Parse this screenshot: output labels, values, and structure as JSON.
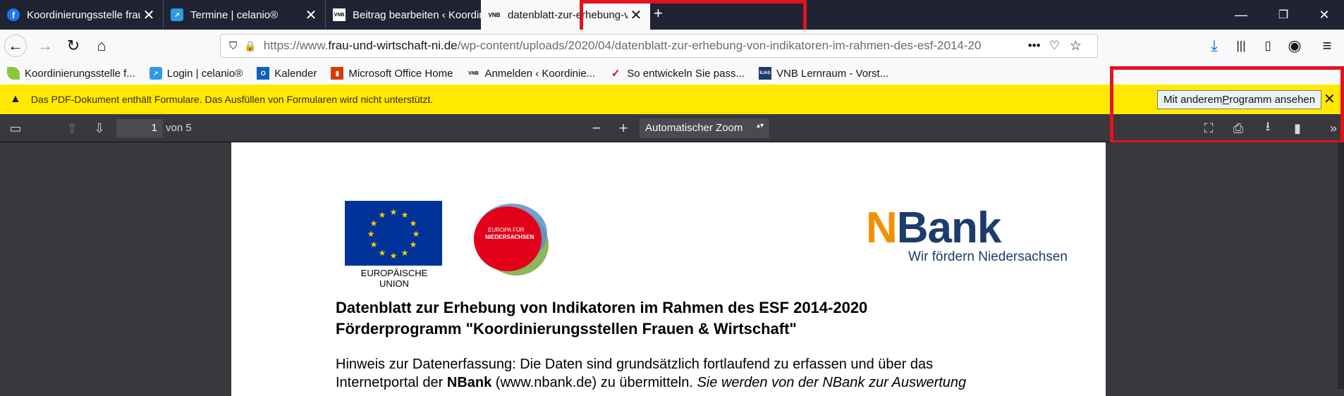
{
  "tabs": [
    {
      "title": "Koordinierungsstelle frau+wirtsc",
      "icon": "facebook-icon",
      "color": "#1877f2"
    },
    {
      "title": "Termine | celanio®",
      "icon": "celanio-icon",
      "color": "#2e9be6"
    },
    {
      "title": "Beitrag bearbeiten ‹ Koordinier",
      "icon": "vnb-icon",
      "color": "#ffffff"
    },
    {
      "title": "datenblatt-zur-erhebung-von-i",
      "icon": "vnb-icon",
      "color": "#ffffff",
      "active": true
    }
  ],
  "tab_favicon_text": {
    "vnb": "VNB"
  },
  "new_tab": "+",
  "url": {
    "prefix": "https://www.",
    "domain": "frau-und-wirtschaft-ni.de",
    "path": "/wp-content/uploads/2020/04/datenblatt-zur-erhebung-von-indikatoren-im-rahmen-des-esf-2014-20"
  },
  "bookmarks": [
    {
      "label": "Koordinierungsstelle f...",
      "icon": "bookmark-leaf-icon",
      "color": "#8cc63f"
    },
    {
      "label": "Login | celanio®",
      "icon": "celanio-icon",
      "color": "#2e9be6"
    },
    {
      "label": "Kalender",
      "icon": "outlook-icon",
      "color": "#0f5fbf"
    },
    {
      "label": "Microsoft Office Home",
      "icon": "office-icon",
      "color": "#d83b01"
    },
    {
      "label": "Anmelden ‹ Koordinie...",
      "icon": "vnb-icon",
      "color": "#ffffff"
    },
    {
      "label": "So entwickeln Sie pass...",
      "icon": "check-icon",
      "color": "#d0021b"
    },
    {
      "label": "VNB Lernraum - Vorst...",
      "icon": "ilias-icon",
      "color": "#1d3b6b"
    }
  ],
  "notification": {
    "message": "Das PDF-Dokument enthält Formulare. Das Ausfüllen von Formularen wird nicht unterstützt.",
    "button_pre": "Mit anderem ",
    "button_underline": "P",
    "button_post": "rogramm ansehen"
  },
  "pdf_toolbar": {
    "page_number": "1",
    "page_count_label": "von 5",
    "zoom": "Automatischer Zoom"
  },
  "document": {
    "eu_label": "EUROPÄISCHE UNION",
    "nieder_label_1": "EUROPA FÜR",
    "nieder_label_2": "NIEDERSACHSEN",
    "nbank_n": "N",
    "nbank_rest": "Bank",
    "nbank_sub": "Wir fördern Niedersachsen",
    "heading_1": "Datenblatt zur Erhebung von Indikatoren im Rahmen des ESF 2014-2020",
    "heading_2": "Förderprogramm \"Koordinierungsstellen Frauen & Wirtschaft\"",
    "para_1a": "Hinweis zur Datenerfassung: Die Daten sind grundsätzlich fortlaufend zu erfassen und über das",
    "para_1b_pre": "Internetportal der ",
    "para_1b_bold": "NBank",
    "para_1b_mid": " (www.nbank.de) zu übermitteln. ",
    "para_1b_italic": "Sie werden von der NBank zur Auswertung"
  },
  "colors": {
    "accent": "#0060df",
    "notification": "#ffe900",
    "highlight_frame": "#e0141e",
    "nbank_orange": "#f29100",
    "nbank_blue": "#1d3b6b"
  }
}
